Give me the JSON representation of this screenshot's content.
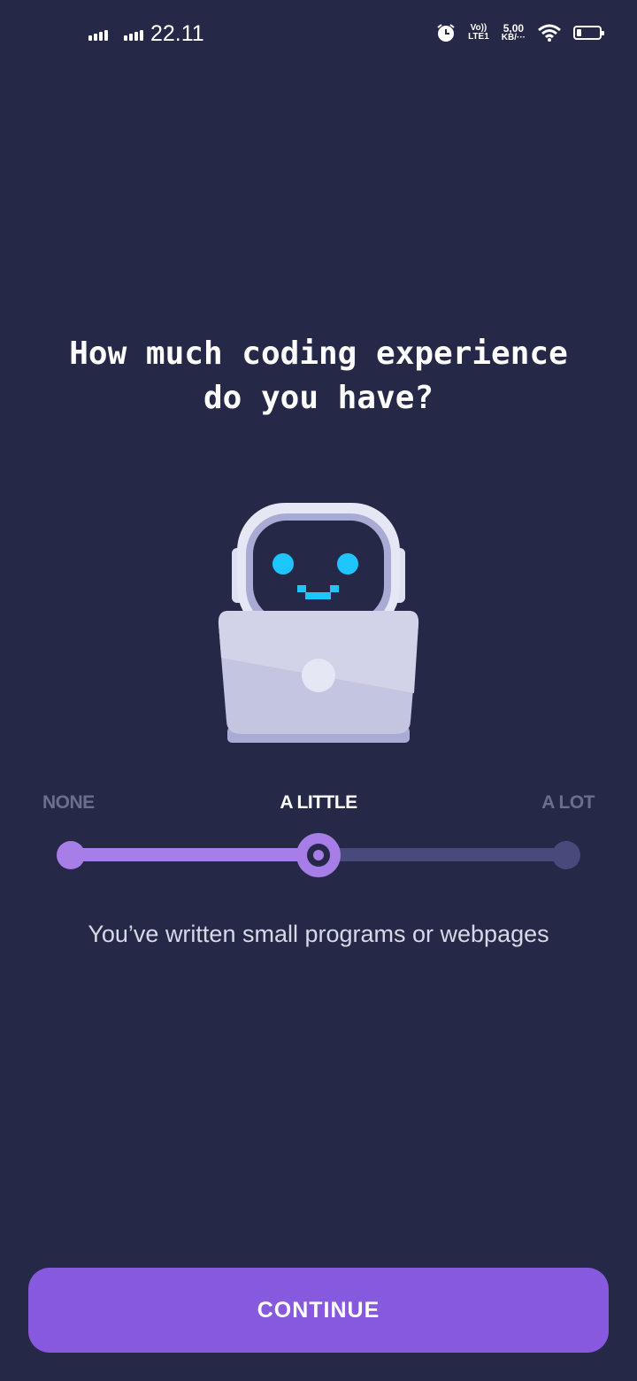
{
  "status_bar": {
    "time": "22.11",
    "network_label_top": "Vo)) ",
    "network_label_bottom": "LTE1",
    "speed_value": "5,00",
    "speed_unit": "KB/···",
    "icons": [
      "signal-icon",
      "signal-icon",
      "alarm-icon",
      "wifi-icon",
      "battery-icon"
    ]
  },
  "onboarding": {
    "question": "How much coding experience\ndo you have?",
    "illustration": "robot-with-laptop",
    "levels": [
      "NONE",
      "A LITTLE",
      "A LOT"
    ],
    "selected_level": "A LITTLE",
    "slider_position_fraction": 0.5,
    "description": "You’ve written small programs or webpages",
    "continue_label": "CONTINUE"
  },
  "colors": {
    "background": "#252847",
    "accent": "#a77de8",
    "button": "#8659de",
    "track_inactive": "#484a7c",
    "robot_eyes": "#1ec5ff"
  }
}
